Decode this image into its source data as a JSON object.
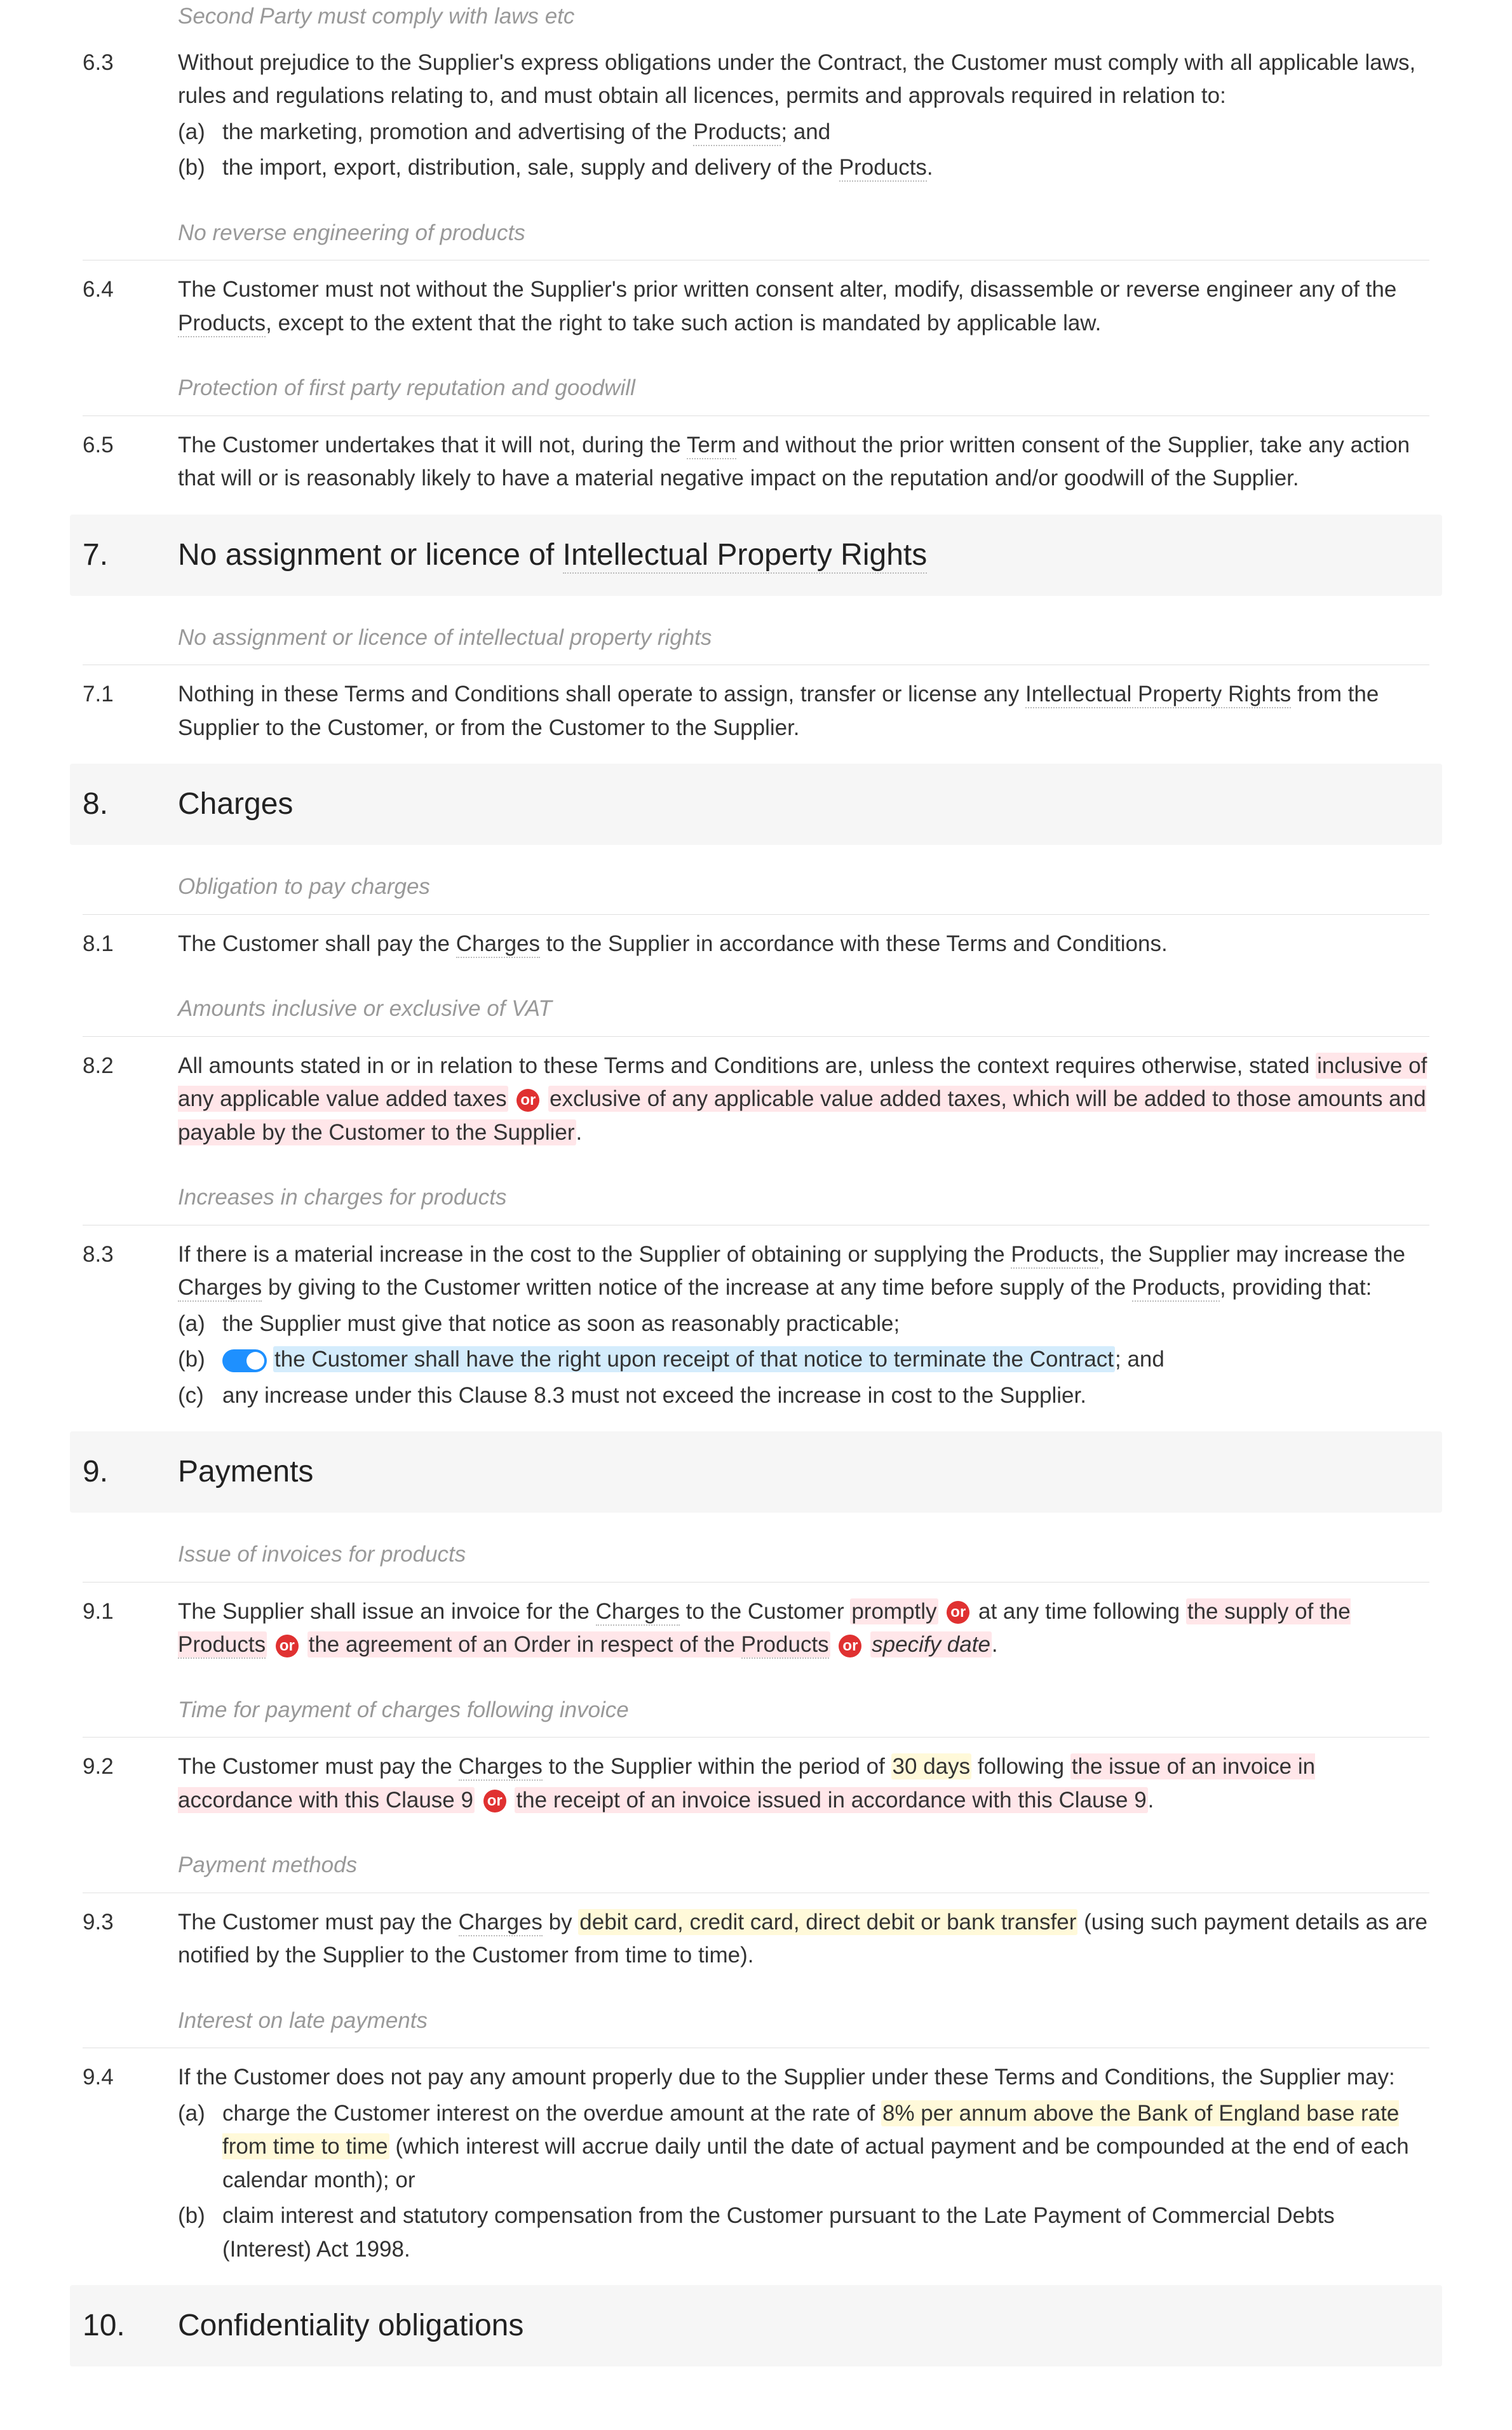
{
  "clause_6_caption_top": "Second Party must comply with laws etc",
  "clause_6_3": {
    "num": "6.3",
    "text_before": "Without prejudice to the Supplier's express obligations under the Contract, the Customer must comply with all applicable laws, rules and regulations relating to, and must obtain all licences, permits and approvals required in relation to:",
    "a_num": "(a)",
    "a_text_before": "the marketing, promotion and advertising of the ",
    "a_term": "Products",
    "a_text_after": "; and",
    "b_num": "(b)",
    "b_text_before": "the import, export, distribution, sale, supply and delivery of the ",
    "b_term": "Products",
    "b_text_after": "."
  },
  "caption_6_4": "No reverse engineering of products",
  "clause_6_4": {
    "num": "6.4",
    "text_1": "The Customer must not without the Supplier's prior written consent alter, modify, disassemble or reverse engineer any of the ",
    "term": "Products",
    "text_2": ", except to the extent that the right to take such action is mandated by applicable law."
  },
  "caption_6_5": "Protection of first party reputation and goodwill",
  "clause_6_5": {
    "num": "6.5",
    "text_1": "The Customer undertakes that it will not, during the ",
    "term": "Term",
    "text_2": " and without the prior written consent of the Supplier, take any action that will or is reasonably likely to have a material negative impact on the reputation and/or goodwill of the Supplier."
  },
  "section_7": {
    "num": "7.",
    "title_before": "No assignment or licence of ",
    "title_term": "Intellectual Property Rights"
  },
  "caption_7_1": "No assignment or licence of intellectual property rights",
  "clause_7_1": {
    "num": "7.1",
    "text_1": "Nothing in these Terms and Conditions shall operate to assign, transfer or license any ",
    "term": "Intellectual Property Rights",
    "text_2": " from the Supplier to the Customer, or from the Customer to the Supplier."
  },
  "section_8": {
    "num": "8.",
    "title": "Charges"
  },
  "caption_8_1": "Obligation to pay charges",
  "clause_8_1": {
    "num": "8.1",
    "text_1": "The Customer shall pay the ",
    "term": "Charges",
    "text_2": " to the Supplier in accordance with these Terms and Conditions."
  },
  "caption_8_2": "Amounts inclusive or exclusive of VAT",
  "clause_8_2": {
    "num": "8.2",
    "text_1": "All amounts stated in or in relation to these Terms and Conditions are, unless the context requires otherwise, stated ",
    "opt1": "inclusive of any applicable value added taxes",
    "or": "or",
    "opt2": "exclusive of any applicable value added taxes, which will be added to those amounts and payable by the Customer to the Supplier",
    "text_end": "."
  },
  "caption_8_3": "Increases in charges for products",
  "clause_8_3": {
    "num": "8.3",
    "text_1": "If there is a material increase in the cost to the Supplier of obtaining or supplying the ",
    "term1": "Products",
    "text_2": ", the Supplier may increase the ",
    "term2": "Charges",
    "text_3": " by giving to the Customer written notice of the increase at any time before supply of the ",
    "term3": "Products",
    "text_4": ", providing that:",
    "a_num": "(a)",
    "a_text": "the Supplier must give that notice as soon as reasonably practicable;",
    "b_num": "(b)",
    "b_opt": "the Customer shall have the right upon receipt of that notice to terminate the Contract",
    "b_after": "; and",
    "c_num": "(c)",
    "c_text": "any increase under this Clause 8.3 must not exceed the increase in cost to the Supplier."
  },
  "section_9": {
    "num": "9.",
    "title": "Payments"
  },
  "caption_9_1": "Issue of invoices for products",
  "clause_9_1": {
    "num": "9.1",
    "text_1": "The Supplier shall issue an invoice for the ",
    "term1": "Charges",
    "text_2": " to the Customer ",
    "opt1": "promptly",
    "or": "or",
    "text_3": " at any time following ",
    "opt2a": "the supply of the ",
    "opt2a_term": "Products",
    "opt2b": "the agreement of an Order in respect of the ",
    "opt2b_term": "Products",
    "placeholder": "specify date",
    "text_end": "."
  },
  "caption_9_2": "Time for payment of charges following invoice",
  "clause_9_2": {
    "num": "9.2",
    "text_1": "The Customer must pay the ",
    "term": "Charges",
    "text_2": " to the Supplier within the period of ",
    "days": "30 days",
    "text_3": " following ",
    "opt1": "the issue of an invoice in accordance with this Clause 9",
    "or": "or",
    "opt2": "the receipt of an invoice issued in accordance with this Clause 9",
    "text_end": "."
  },
  "caption_9_3": "Payment methods",
  "clause_9_3": {
    "num": "9.3",
    "text_1": "The Customer must pay the ",
    "term": "Charges",
    "text_2": " by ",
    "methods": "debit card, credit card, direct debit or bank transfer",
    "text_3": " (using such payment details as are notified by the Supplier to the Customer from time to time)."
  },
  "caption_9_4": "Interest on late payments",
  "clause_9_4": {
    "num": "9.4",
    "text_1": "If the Customer does not pay any amount properly due to the Supplier under these Terms and Conditions, the Supplier may:",
    "a_num": "(a)",
    "a_text_1": "charge the Customer interest on the overdue amount at the rate of ",
    "a_rate": "8% per annum above the Bank of England base rate from time to time",
    "a_text_2": " (which interest will accrue daily until the date of actual payment and be compounded at the end of each calendar month); or",
    "b_num": "(b)",
    "b_text": "claim interest and statutory compensation from the Customer pursuant to the Late Payment of Commercial Debts (Interest) Act 1998."
  },
  "section_10": {
    "num": "10.",
    "title": "Confidentiality obligations"
  }
}
